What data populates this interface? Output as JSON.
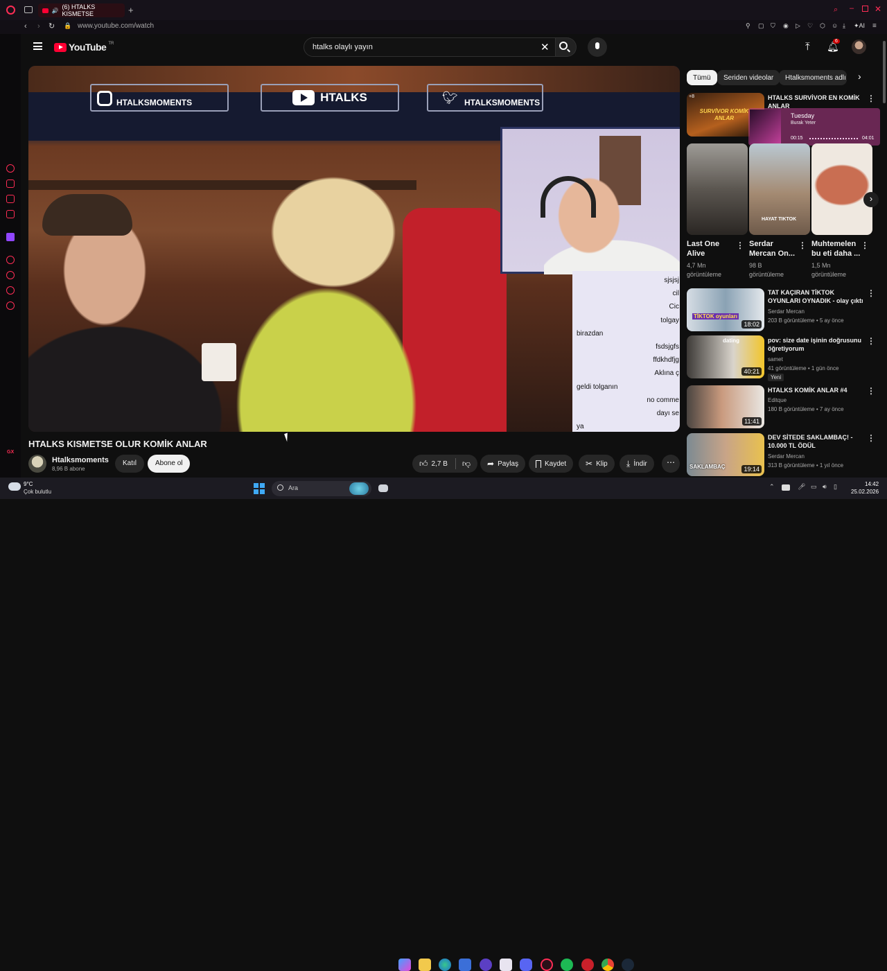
{
  "browser": {
    "tab_title": "(6) HTALKS KISMETSE",
    "new_tab": "+",
    "url": "www.youtube.com/watch",
    "ai_label": "AI"
  },
  "youtube": {
    "logo_text": "YouTube",
    "region": "TR",
    "search_value": "htalks olaylı yayın",
    "notification_count": "6"
  },
  "video": {
    "title": "HTALKS KISMETSE OLUR KOMİK ANLAR",
    "overlay_socials": [
      "HTALKSMOMENTS",
      "HTALKS",
      "HTALKSMOMENTS"
    ],
    "chat_lines": [
      "sjsjsj",
      "cil",
      "Cic",
      "tolgay",
      "birazdan",
      "fsdsjgfs",
      "ffdkhdfjg",
      "Aklına ç",
      "geldi tolganın",
      "no comme",
      "dayı se",
      "ya"
    ]
  },
  "channel": {
    "name": "Htalksmoments",
    "subscribers": "8,96 B abone",
    "join_label": "Katıl",
    "subscribe_label": "Abone ol"
  },
  "actions": {
    "likes": "2,7 B",
    "share": "Paylaş",
    "save": "Kaydet",
    "clip": "Klip",
    "download": "İndir"
  },
  "chips": [
    "Tümü",
    "Seriden videolar",
    "Htalksmoments adlı k"
  ],
  "miniplayer": {
    "song": "Tuesday",
    "artist": "Burak Yeter",
    "time_current": "00:15",
    "time_total": "04:01",
    "thumb_text": "SURVİVOR KOMİK ANLAR"
  },
  "recommended_top": {
    "title": "HTALKS SURVİVOR EN KOMİK ANLAR",
    "badge": "+8"
  },
  "shorts": [
    {
      "title1": "Last One",
      "title2": "Alive",
      "views": "4,7 Mn",
      "views_label": "görüntüleme",
      "overlay": ""
    },
    {
      "title1": "Serdar",
      "title2": "Mercan On...",
      "views": "98 B",
      "views_label": "görüntüleme",
      "overlay": "HAYAT TIKTOK"
    },
    {
      "title1": "Muhtemelen",
      "title2": "bu eti daha ...",
      "views": "1,5 Mn",
      "views_label": "görüntüleme",
      "overlay": ""
    }
  ],
  "recommended": [
    {
      "title": "TAT KAÇIRAN TİKTOK OYUNLARI OYNADIK - olay çıktı",
      "channel": "Serdar Mercan",
      "meta": "203 B görüntüleme • 5 ay önce",
      "duration": "18:02",
      "badge": "",
      "thumb_text": "TİKTOK oyunları"
    },
    {
      "title": "pov: size date işinin doğrusunu öğretiyorum",
      "channel": "samet",
      "meta": "41 görüntüleme • 1 gün önce",
      "duration": "40:21",
      "badge": "Yeni",
      "thumb_text": "dating"
    },
    {
      "title": "HTALKS KOMİK ANLAR #4",
      "channel": "Editque",
      "meta": "180 B görüntüleme • 7 ay önce",
      "duration": "11:41",
      "badge": "",
      "thumb_text": ""
    },
    {
      "title": "DEV SİTEDE SAKLAMBAÇ! - 10.000 TL ÖDÜL",
      "channel": "Serdar Mercan",
      "meta": "313 B görüntüleme • 1 yıl önce",
      "duration": "19:14",
      "badge": "",
      "thumb_text": "SAKLAMBAÇ"
    }
  ],
  "taskbar": {
    "weather_temp": "9°C",
    "weather_desc": "Çok bulutlu",
    "search_placeholder": "Ara",
    "time": "14:42",
    "date": "25.02.2026"
  },
  "colors": {
    "accent": "#ff0033",
    "opera_red": "#ff2d55",
    "bg": "#0f0f0f"
  }
}
